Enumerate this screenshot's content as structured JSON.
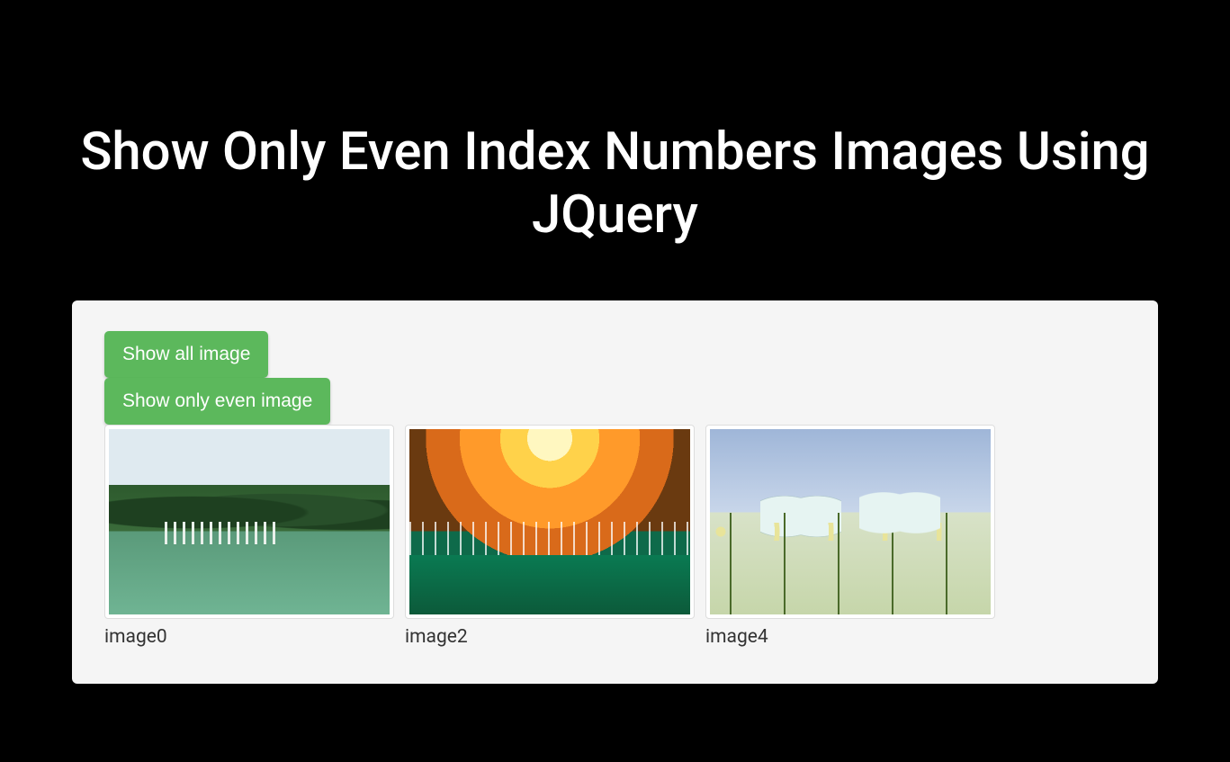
{
  "title": "Show Only Even Index Numbers Images Using JQuery",
  "buttons": {
    "show_all": "Show all image",
    "show_even": "Show only even image"
  },
  "images": [
    {
      "caption": "image0",
      "scene": "lake-waterfall"
    },
    {
      "caption": "image2",
      "scene": "sunset-waterfall"
    },
    {
      "caption": "image4",
      "scene": "butterflies-flowers"
    }
  ]
}
